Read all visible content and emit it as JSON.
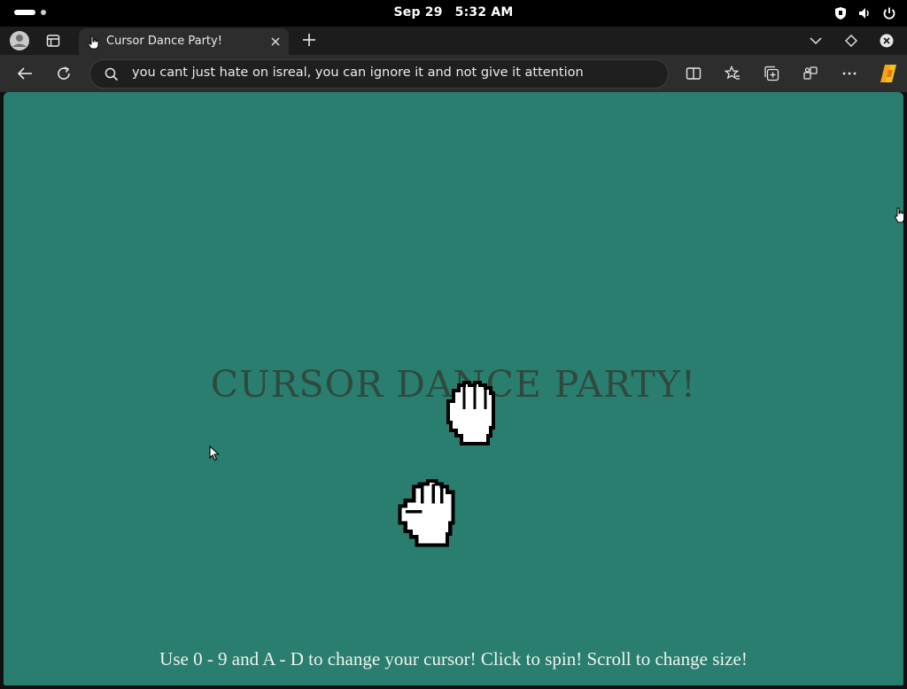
{
  "system": {
    "date": "Sep 29",
    "time": "5:32 AM",
    "tray_icons": [
      "shield-icon",
      "volume-icon",
      "power-icon"
    ]
  },
  "browser": {
    "tab": {
      "title": "Cursor Dance Party!",
      "favicon": "hand-cursor-icon"
    },
    "address_bar": {
      "value": "you cant just hate on isreal, you can ignore it and not give it attention"
    },
    "toolbar_icons": [
      "split-screen-icon",
      "favorites-icon",
      "collections-icon",
      "extensions-icon",
      "more-icon",
      "copilot-icon"
    ]
  },
  "page": {
    "title": "CURSOR DANCE PARTY!",
    "instructions": "Use 0 - 9 and A - D to change your cursor! Click to spin! Scroll to change size!",
    "background_color": "#2a7e6f",
    "cursors": [
      "grab-hand-cursor",
      "fist-hand-cursor",
      "arrow-cursor"
    ]
  },
  "colors": {
    "title_text": "#2f4a3d",
    "instructions_text": "#eef2ef",
    "chrome_dark": "#1c1c1c",
    "chrome_toolbar": "#2d2d2d"
  }
}
